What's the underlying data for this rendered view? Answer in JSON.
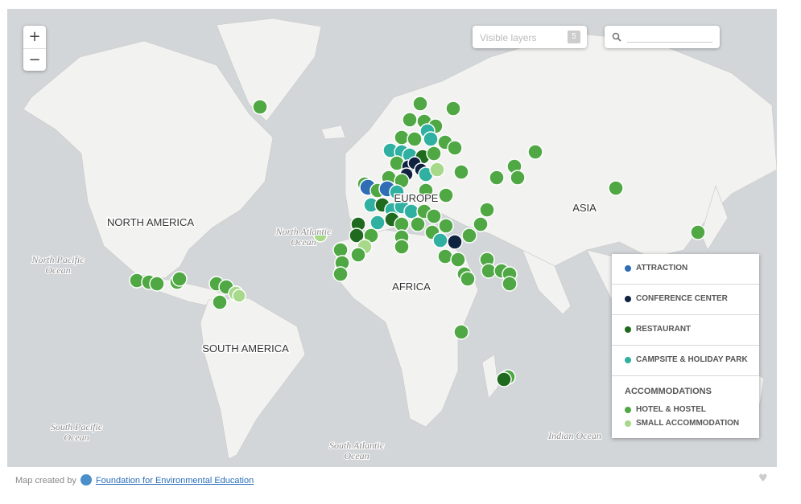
{
  "map": {
    "zoom_in": "+",
    "zoom_out": "−",
    "continents": [
      "NORTH AMERICA",
      "SOUTH AMERICA",
      "EUROPE",
      "AFRICA",
      "ASIA"
    ],
    "oceans": [
      [
        "North Pacific",
        "Ocean"
      ],
      [
        "North Atlantic",
        "Ocean"
      ],
      [
        "South Pacific",
        "Ocean"
      ],
      [
        "South Atlantic",
        "Ocean"
      ],
      [
        "Indian Ocean"
      ]
    ]
  },
  "layers": {
    "placeholder": "Visible layers",
    "count": "5"
  },
  "search": {
    "icon": "search-icon",
    "value": ""
  },
  "legend": {
    "layers": [
      {
        "label": "ATTRACTION",
        "color": "#2f6eb5"
      },
      {
        "label": "CONFERENCE CENTER",
        "color": "#0f2340"
      },
      {
        "label": "RESTAURANT",
        "color": "#1f6a1f"
      },
      {
        "label": "CAMPSITE & HOLIDAY PARK",
        "color": "#2fb0a0"
      }
    ],
    "accommodations_title": "ACCOMMODATIONS",
    "accommodations": [
      {
        "label": "HOTEL & HOSTEL",
        "color": "#4fa843"
      },
      {
        "label": "SMALL ACCOMMODATION",
        "color": "#a8d88a"
      }
    ]
  },
  "footer": {
    "prefix": "Map created by",
    "link": "Foundation for Environmental Education"
  },
  "icons": {
    "heart": "heart-icon",
    "logo": "fee-logo-icon"
  }
}
